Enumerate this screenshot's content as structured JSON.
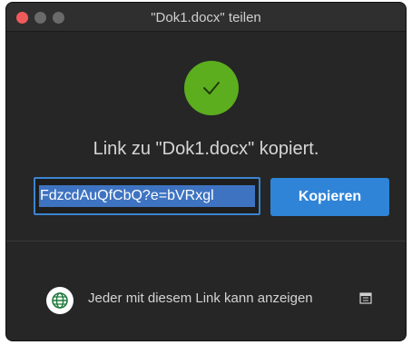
{
  "window": {
    "title": "\"Dok1.docx\" teilen"
  },
  "status": {
    "message": "Link zu \"Dok1.docx\" kopiert."
  },
  "link": {
    "value": "FdzcdAuQfCbQ?e=bVRxgl"
  },
  "actions": {
    "copy_label": "Kopieren"
  },
  "permission": {
    "label": "Jeder mit diesem Link kann anzeigen"
  },
  "colors": {
    "success": "#5cae1e",
    "accent": "#2f84d8",
    "close": "#ef5a5b"
  },
  "icons": [
    "checkmark-icon",
    "globe-icon",
    "calendar-icon"
  ]
}
